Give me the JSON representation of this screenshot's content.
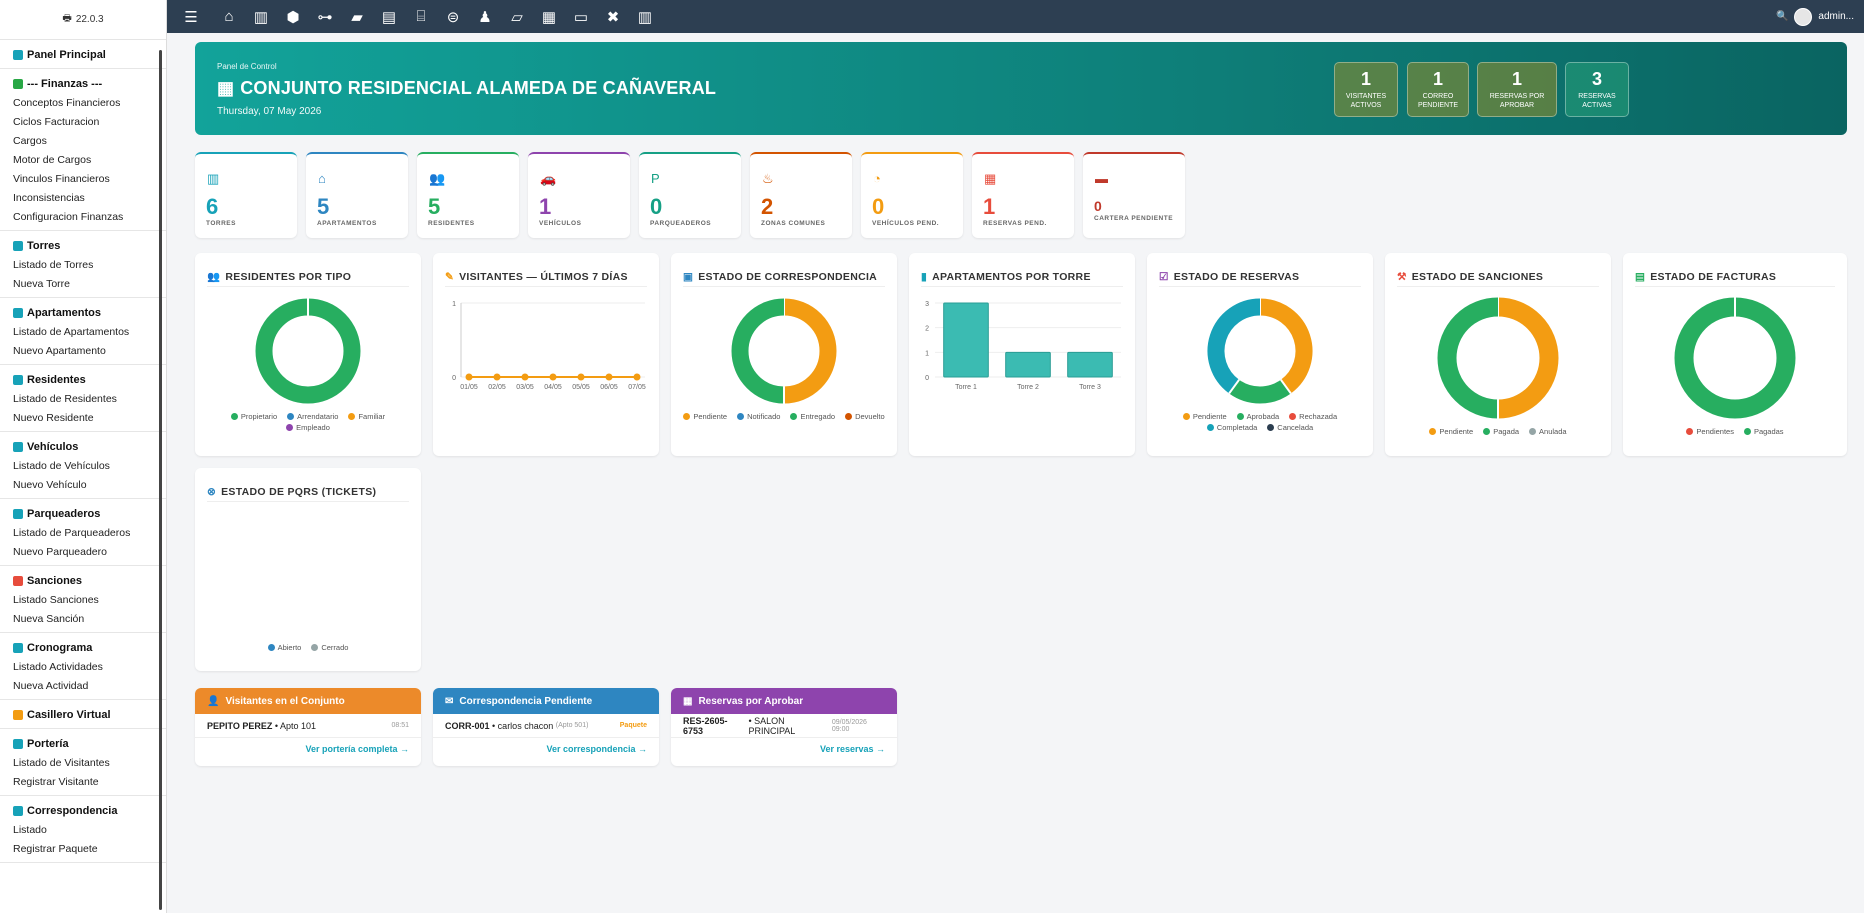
{
  "sidebar": {
    "version": "22.0.3",
    "sections": [
      {
        "title": "Panel Principal",
        "icon": "dashboard-icon",
        "color": "#17a2b8",
        "items": []
      },
      {
        "title": "--- Finanzas ---",
        "icon": "money-icon",
        "color": "#28a745",
        "items": [
          "Conceptos Financieros",
          "Ciclos Facturacion",
          "Cargos",
          "Motor de Cargos",
          "Vinculos Financieros",
          "Inconsistencias",
          "Configuracion Finanzas"
        ]
      },
      {
        "title": "Torres",
        "icon": "building-icon",
        "color": "#17a2b8",
        "items": [
          "Listado de Torres",
          "Nueva Torre"
        ]
      },
      {
        "title": "Apartamentos",
        "icon": "door-icon",
        "color": "#17a2b8",
        "items": [
          "Listado de Apartamentos",
          "Nuevo Apartamento"
        ]
      },
      {
        "title": "Residentes",
        "icon": "users-icon",
        "color": "#17a2b8",
        "items": [
          "Listado de Residentes",
          "Nuevo Residente"
        ]
      },
      {
        "title": "Vehículos",
        "icon": "car-icon",
        "color": "#17a2b8",
        "items": [
          "Listado de Vehículos",
          "Nuevo Vehículo"
        ]
      },
      {
        "title": "Parqueaderos",
        "icon": "parking-icon",
        "color": "#17a2b8",
        "items": [
          "Listado de Parqueaderos",
          "Nuevo Parqueadero"
        ]
      },
      {
        "title": "Sanciones",
        "icon": "gavel-icon",
        "color": "#e74c3c",
        "items": [
          "Listado Sanciones",
          "Nueva Sanción"
        ]
      },
      {
        "title": "Cronograma",
        "icon": "calendar-icon",
        "color": "#17a2b8",
        "items": [
          "Listado Actividades",
          "Nueva Actividad"
        ]
      },
      {
        "title": "Casillero Virtual",
        "icon": "mailbox-icon",
        "color": "#f39c12",
        "items": []
      },
      {
        "title": "Portería",
        "icon": "guard-icon",
        "color": "#17a2b8",
        "items": [
          "Listado de Visitantes",
          "Registrar Visitante"
        ]
      },
      {
        "title": "Correspondencia",
        "icon": "envelope-icon",
        "color": "#17a2b8",
        "items": [
          "Listado",
          "Registrar Paquete"
        ]
      }
    ]
  },
  "topbar": {
    "icons": [
      "menu-icon",
      "home-icon",
      "building-icon",
      "cube-icon",
      "sitemap-icon",
      "briefcase-icon",
      "invoice-icon",
      "bank-icon",
      "search-dollar-icon",
      "user-tie-icon",
      "folder-open-icon",
      "calendar-icon",
      "ticket-icon",
      "tools-icon",
      "building-alt-icon"
    ],
    "user": "admin..."
  },
  "hero": {
    "subtitle": "Panel de Control",
    "title": "CONJUNTO RESIDENCIAL ALAMEDA DE CAÑAVERAL",
    "date": "Thursday, 07 May 2026",
    "stats": [
      {
        "value": "1",
        "label": "VISITANTES ACTIVOS"
      },
      {
        "value": "1",
        "label": "CORREO PENDIENTE"
      },
      {
        "value": "1",
        "label": "RESERVAS POR APROBAR"
      },
      {
        "value": "3",
        "label": "RESERVAS ACTIVAS"
      }
    ]
  },
  "cards": [
    {
      "value": "6",
      "label": "TORRES",
      "icon": "building-icon",
      "color": "#17a2b8"
    },
    {
      "value": "5",
      "label": "APARTAMENTOS",
      "icon": "home-icon",
      "color": "#2e86c1"
    },
    {
      "value": "5",
      "label": "RESIDENTES",
      "icon": "users-icon",
      "color": "#27ae60"
    },
    {
      "value": "1",
      "label": "VEHÍCULOS",
      "icon": "car-icon",
      "color": "#8e44ad"
    },
    {
      "value": "0",
      "label": "PARQUEADEROS",
      "icon": "parking-icon",
      "color": "#16a085"
    },
    {
      "value": "2",
      "label": "ZONAS COMUNES",
      "icon": "swimming-icon",
      "color": "#d35400"
    },
    {
      "value": "0",
      "label": "VEHÍCULOS PEND.",
      "icon": "user-clock-icon",
      "color": "#f39c12"
    },
    {
      "value": "1",
      "label": "RESERVAS PEND.",
      "icon": "calendar-check-icon",
      "color": "#e74c3c"
    },
    {
      "value": "0",
      "label": "CARTERA PENDIENTE",
      "icon": "wallet-icon",
      "color": "#c0392b"
    }
  ],
  "panels": {
    "residentes": {
      "title": "RESIDENTES POR TIPO",
      "legend": [
        {
          "l": "Propietario",
          "c": "#27ae60"
        },
        {
          "l": "Arrendatario",
          "c": "#2e86c1"
        },
        {
          "l": "Familiar",
          "c": "#f39c12"
        },
        {
          "l": "Empleado",
          "c": "#8e44ad"
        }
      ]
    },
    "visitantes": {
      "title": "VISITANTES — ÚLTIMOS 7 DÍAS"
    },
    "correspondencia": {
      "title": "ESTADO DE CORRESPONDENCIA",
      "legend": [
        {
          "l": "Pendiente",
          "c": "#f39c12"
        },
        {
          "l": "Notificado",
          "c": "#2e86c1"
        },
        {
          "l": "Entregado",
          "c": "#27ae60"
        },
        {
          "l": "Devuelto",
          "c": "#d35400"
        }
      ]
    },
    "aptos": {
      "title": "APARTAMENTOS POR TORRE"
    },
    "reservas": {
      "title": "ESTADO DE RESERVAS",
      "legend": [
        {
          "l": "Pendiente",
          "c": "#f39c12"
        },
        {
          "l": "Aprobada",
          "c": "#27ae60"
        },
        {
          "l": "Rechazada",
          "c": "#e74c3c"
        },
        {
          "l": "Completada",
          "c": "#17a2b8"
        },
        {
          "l": "Cancelada",
          "c": "#2c3e50"
        }
      ]
    },
    "sanciones": {
      "title": "ESTADO DE SANCIONES",
      "legend": [
        {
          "l": "Pendiente",
          "c": "#f39c12"
        },
        {
          "l": "Pagada",
          "c": "#27ae60"
        },
        {
          "l": "Anulada",
          "c": "#95a5a6"
        }
      ]
    },
    "facturas": {
      "title": "ESTADO DE FACTURAS",
      "legend": [
        {
          "l": "Pendientes",
          "c": "#e74c3c"
        },
        {
          "l": "Pagadas",
          "c": "#27ae60"
        }
      ]
    },
    "pqrs": {
      "title": "ESTADO DE PQRS (TICKETS)",
      "legend": [
        {
          "l": "Abierto",
          "c": "#2e86c1"
        },
        {
          "l": "Cerrado",
          "c": "#95a5a6"
        }
      ]
    }
  },
  "chart_data": [
    {
      "type": "pie",
      "title": "RESIDENTES POR TIPO",
      "categories": [
        "Propietario",
        "Arrendatario",
        "Familiar",
        "Empleado"
      ],
      "values": [
        5,
        0,
        0,
        0
      ]
    },
    {
      "type": "line",
      "title": "VISITANTES — ÚLTIMOS 7 DÍAS",
      "x": [
        "01/05",
        "02/05",
        "03/05",
        "04/05",
        "05/05",
        "06/05",
        "07/05"
      ],
      "values": [
        0,
        0,
        0,
        0,
        0,
        0,
        0
      ],
      "ylim": [
        0,
        1
      ],
      "color": "#f39c12"
    },
    {
      "type": "pie",
      "title": "ESTADO DE CORRESPONDENCIA",
      "categories": [
        "Pendiente",
        "Notificado",
        "Entregado",
        "Devuelto"
      ],
      "values": [
        1,
        0,
        1,
        0
      ]
    },
    {
      "type": "bar",
      "title": "APARTAMENTOS POR TORRE",
      "categories": [
        "Torre 1",
        "Torre 2",
        "Torre 3"
      ],
      "values": [
        3,
        1,
        1
      ],
      "ylim": [
        0,
        3
      ],
      "color": "#3bbbb2"
    },
    {
      "type": "pie",
      "title": "ESTADO DE RESERVAS",
      "categories": [
        "Pendiente",
        "Aprobada",
        "Rechazada",
        "Completada",
        "Cancelada"
      ],
      "values": [
        2,
        1,
        0,
        2,
        0
      ]
    },
    {
      "type": "pie",
      "title": "ESTADO DE SANCIONES",
      "categories": [
        "Pendiente",
        "Pagada",
        "Anulada"
      ],
      "values": [
        1,
        1,
        0
      ]
    },
    {
      "type": "pie",
      "title": "ESTADO DE FACTURAS",
      "categories": [
        "Pendientes",
        "Pagadas"
      ],
      "values": [
        0,
        1
      ]
    },
    {
      "type": "pie",
      "title": "ESTADO DE PQRS (TICKETS)",
      "categories": [
        "Abierto",
        "Cerrado"
      ],
      "values": [
        0,
        0
      ]
    }
  ],
  "bottom": {
    "visitantes": {
      "title": "Visitantes en el Conjunto",
      "color": "#ec8a2a",
      "name": "PEPITO PEREZ",
      "detail": "• Apto 101",
      "time": "08:51",
      "link": "Ver portería completa →",
      "linkColor": "#17a2b8"
    },
    "correspondencia": {
      "title": "Correspondencia Pendiente",
      "color": "#2e86c1",
      "name": "CORR-001",
      "detail": "• carlos chacon",
      "extra": "(Apto 501)",
      "badge": "Paquete",
      "link": "Ver correspondencia →",
      "linkColor": "#17a2b8"
    },
    "reservas": {
      "title": "Reservas por Aprobar",
      "color": "#8e44ad",
      "name": "RES-2605-6753",
      "detail": "• SALON PRINCIPAL",
      "time": "09/05/2026 09:00",
      "link": "Ver reservas →",
      "linkColor": "#17a2b8"
    }
  }
}
